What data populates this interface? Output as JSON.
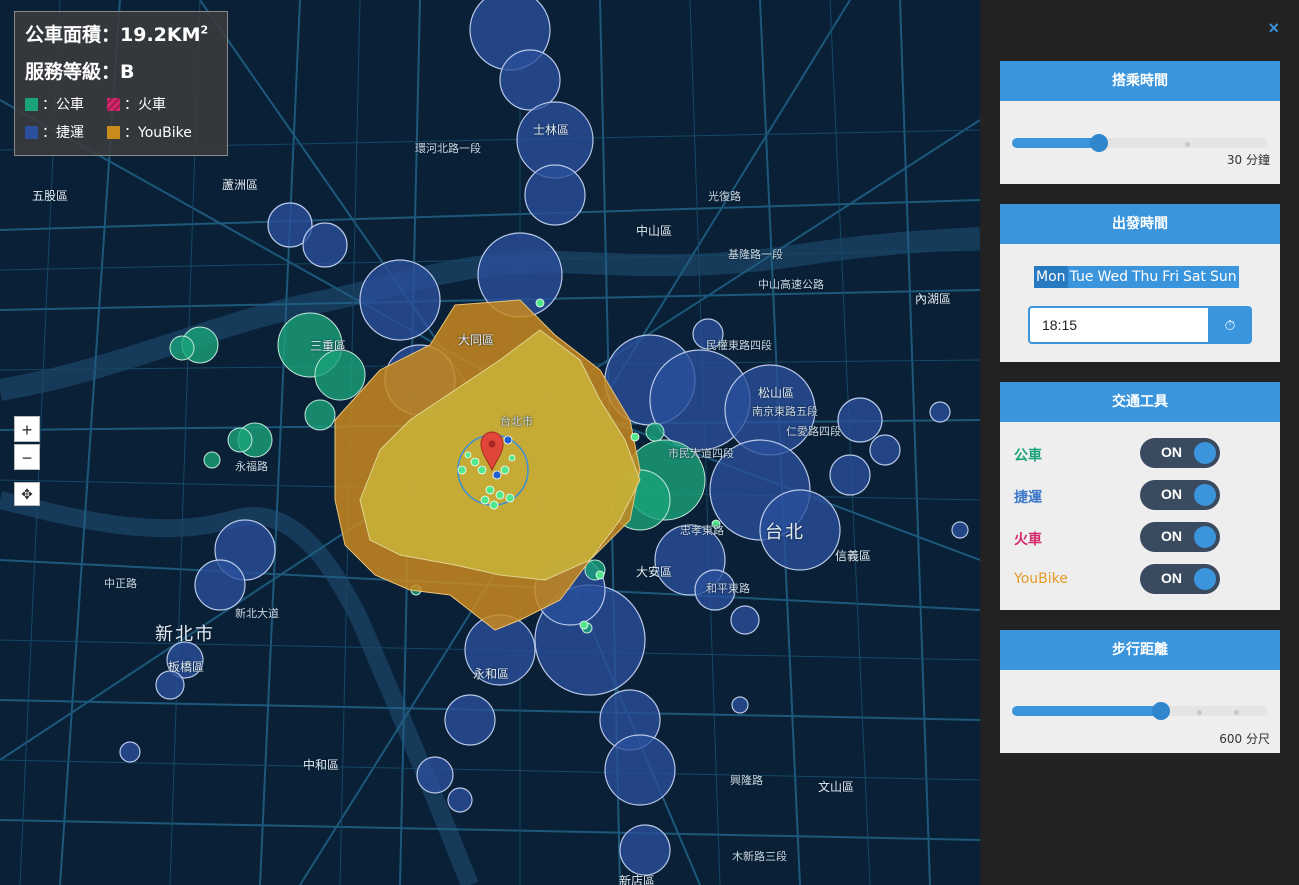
{
  "info": {
    "area_label": "公車面積：",
    "area_value": "19.2KM",
    "area_sup": "2",
    "level_label": "服務等級：",
    "level_value": "B",
    "legend": [
      {
        "label": "：公車",
        "color": "#1aa27a",
        "name": "bus"
      },
      {
        "label": "：火車",
        "color": "#d4286a",
        "name": "train"
      },
      {
        "label": "：捷運",
        "color": "#2a4f9c",
        "name": "mrt"
      },
      {
        "label": "：YouBike",
        "color": "#c98a1e",
        "name": "youbike"
      }
    ]
  },
  "map": {
    "zoom_in": "+",
    "zoom_out": "−",
    "locate": "✥",
    "labels": [
      {
        "t": "新北市",
        "big": true
      },
      {
        "t": "台北",
        "big": true
      },
      {
        "t": "士林區",
        "district": true
      },
      {
        "t": "大同區",
        "district": true
      },
      {
        "t": "松山區",
        "district": true
      },
      {
        "t": "大安區",
        "district": true
      },
      {
        "t": "信義區",
        "district": true
      },
      {
        "t": "中山區",
        "district": true
      },
      {
        "t": "內湖區",
        "district": true
      },
      {
        "t": "三重區",
        "district": true
      },
      {
        "t": "永和區",
        "district": true
      },
      {
        "t": "中和區",
        "district": true
      },
      {
        "t": "文山區",
        "district": true
      },
      {
        "t": "板橋區",
        "district": true
      },
      {
        "t": "蘆洲區",
        "district": true
      },
      {
        "t": "五股區",
        "district": true
      },
      {
        "t": "中山高速公路"
      },
      {
        "t": "環河北路一段"
      },
      {
        "t": "民權東路四段"
      },
      {
        "t": "南京東路五段"
      },
      {
        "t": "市民大道四段"
      },
      {
        "t": "忠孝東路"
      },
      {
        "t": "和平東路"
      },
      {
        "t": "基隆路一段"
      },
      {
        "t": "永福路"
      },
      {
        "t": "新北大道"
      },
      {
        "t": "中正路"
      },
      {
        "t": "仁愛路四段"
      },
      {
        "t": "台北市"
      },
      {
        "t": "新店區"
      },
      {
        "t": "木新路三段"
      },
      {
        "t": "興隆路"
      },
      {
        "t": "光復路"
      }
    ]
  },
  "sidebar": {
    "close": "×",
    "ride_time": {
      "title": "搭乘時間",
      "value_text": "30 分鐘",
      "value_fraction": 0.34
    },
    "depart": {
      "title": "出發時間",
      "days": [
        "Mon",
        "Tue",
        "Wed",
        "Thu",
        "Fri",
        "Sat",
        "Sun"
      ],
      "selected_day": "Mon",
      "time": "18:15",
      "clock_icon": "⏱"
    },
    "transport": {
      "title": "交通工具",
      "modes": [
        {
          "label": "公車",
          "color": "#1aa27a",
          "state": "ON"
        },
        {
          "label": "捷運",
          "color": "#3c78c8",
          "state": "ON"
        },
        {
          "label": "火車",
          "color": "#d4286a",
          "state": "ON"
        },
        {
          "label": "YouBike",
          "color": "#e39a26",
          "state": "ON"
        }
      ]
    },
    "walk": {
      "title": "步行距離",
      "value_text": "600 分尺",
      "value_fraction": 0.58
    }
  }
}
